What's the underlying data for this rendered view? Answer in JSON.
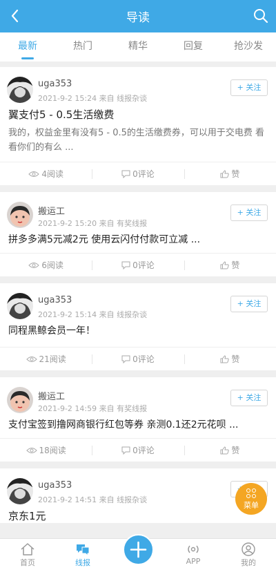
{
  "header": {
    "title": "导读"
  },
  "tabs": [
    "最新",
    "热门",
    "精华",
    "回复",
    "抢沙发"
  ],
  "posts": [
    {
      "user": "uga353",
      "meta": "2021-9-2 15:24  来自 线报杂谈",
      "follow": "+ 关注",
      "title": "翼支付5 - 0.5生活缴费",
      "desc": "我的，权益金里有没有5 - 0.5的生活缴费券，可以用于交电费 看看你们的有么 ...",
      "reads": "4阅读",
      "comments": "0评论",
      "like": "赞"
    },
    {
      "user": "搬运工",
      "meta": "2021-9-2 15:20  来自 有奖线报",
      "follow": "+ 关注",
      "title": "拼多多满5元减2元 使用云闪付付款可立减 ...",
      "desc": "",
      "reads": "6阅读",
      "comments": "0评论",
      "like": "赞"
    },
    {
      "user": "uga353",
      "meta": "2021-9-2 15:14  来自 线报杂谈",
      "follow": "+ 关注",
      "title": "同程黑鲸会员一年！",
      "desc": "",
      "reads": "21阅读",
      "comments": "0评论",
      "like": "赞"
    },
    {
      "user": "搬运工",
      "meta": "2021-9-2 14:59  来自 有奖线报",
      "follow": "+ 关注",
      "title": "支付宝签到撸网商银行红包等券 亲测0.1还2元花呗 ...",
      "desc": "",
      "reads": "18阅读",
      "comments": "0评论",
      "like": "赞"
    },
    {
      "user": "uga353",
      "meta": "2021-9-2 14:51  来自 线报杂谈",
      "follow": "+ 关注",
      "title": "京东1元",
      "desc": "",
      "reads": "",
      "comments": "",
      "like": ""
    }
  ],
  "fab_menu": "菜单",
  "bottom_nav": [
    "首页",
    "线报",
    "",
    "APP",
    "我的"
  ],
  "colors": {
    "accent": "#3fa9e6",
    "menu": "#f4a623"
  }
}
